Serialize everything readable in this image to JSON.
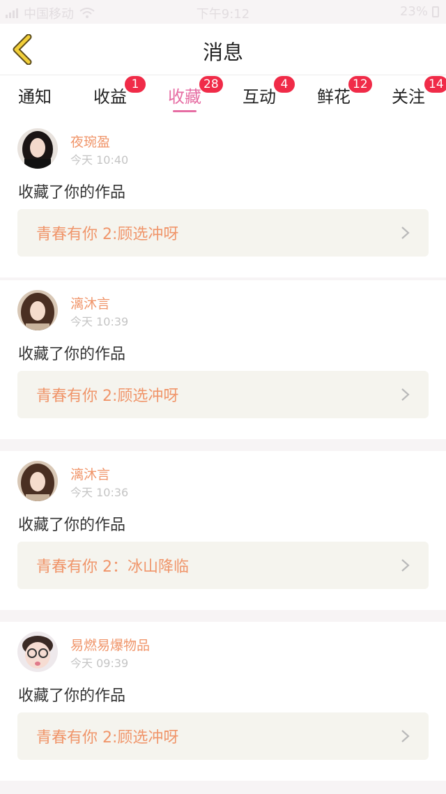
{
  "status_bar": {
    "carrier": "中国移动",
    "time": "下午9:12",
    "battery": "23%"
  },
  "nav": {
    "title": "消息",
    "back_icon": "chevron-left-icon"
  },
  "tabs": [
    {
      "label": "通知",
      "badge": ""
    },
    {
      "label": "收益",
      "badge": "1"
    },
    {
      "label": "收藏",
      "badge": "28",
      "active": true
    },
    {
      "label": "互动",
      "badge": "4"
    },
    {
      "label": "鲜花",
      "badge": "12"
    },
    {
      "label": "关注",
      "badge": "14"
    }
  ],
  "messages": [
    {
      "user": "夜琬盈",
      "time": "今天 10:40",
      "action": "收藏了你的作品",
      "work": "青春有你 2:顾选冲呀"
    },
    {
      "user": "漓沐言",
      "time": "今天 10:39",
      "action": "收藏了你的作品",
      "work": "青春有你 2:顾选冲呀"
    },
    {
      "user": "漓沐言",
      "time": "今天 10:36",
      "action": "收藏了你的作品",
      "work": "青春有你 2：冰山降临"
    },
    {
      "user": "易燃易爆物品",
      "time": "今天 09:39",
      "action": "收藏了你的作品",
      "work": "青春有你 2:顾选冲呀"
    }
  ],
  "colors": {
    "accent": "#e66da3",
    "badge": "#f02b48",
    "name": "#f0956a",
    "back_icon": "#f2cf3a"
  }
}
